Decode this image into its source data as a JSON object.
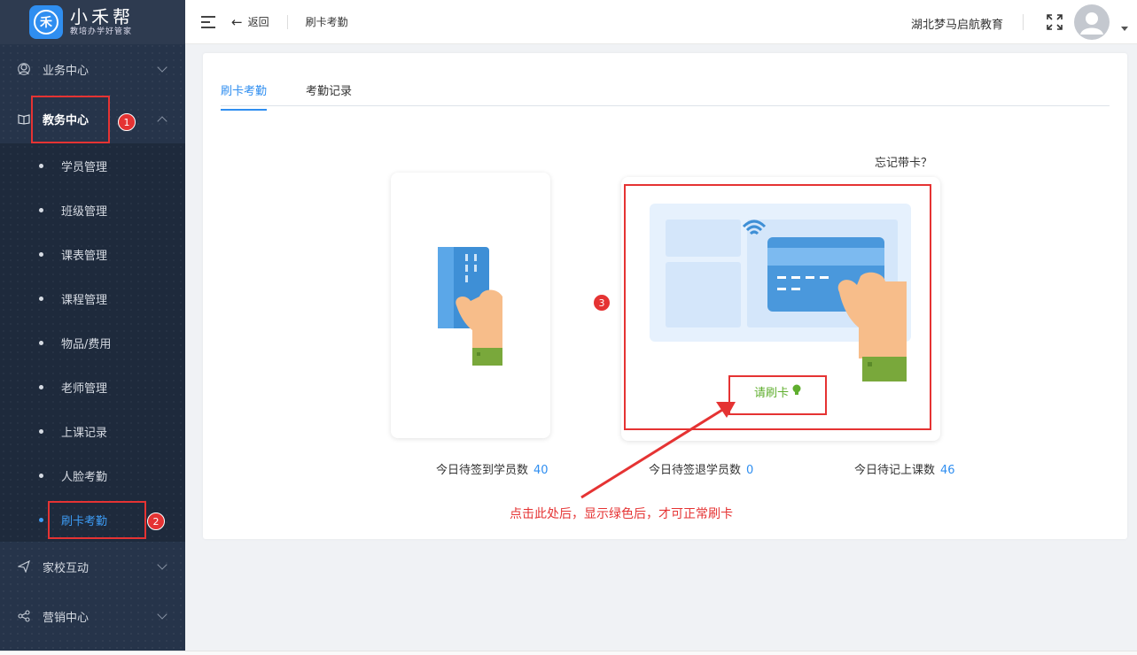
{
  "app": {
    "logo_name": "小禾帮",
    "logo_sub": "教培办学好管家",
    "logo_glyph": "禾"
  },
  "sidebar": {
    "groups": [
      {
        "label": "业务中心",
        "icon": "user-icon"
      },
      {
        "label": "教务中心",
        "icon": "book-icon"
      }
    ],
    "sub_items": [
      "学员管理",
      "班级管理",
      "课表管理",
      "课程管理",
      "物品/费用",
      "老师管理",
      "上课记录",
      "人脸考勤",
      "刷卡考勤"
    ],
    "bottom_groups": [
      {
        "label": "家校互动",
        "icon": "send-icon"
      },
      {
        "label": "营销中心",
        "icon": "share-icon"
      }
    ],
    "active_item": "刷卡考勤"
  },
  "header": {
    "back_label": "返回",
    "breadcrumb": "刷卡考勤",
    "org_name": "湖北梦马启航教育"
  },
  "tabs": [
    {
      "label": "刷卡考勤",
      "active": true
    },
    {
      "label": "考勤记录",
      "active": false
    }
  ],
  "main": {
    "forgot_card": "忘记带卡？",
    "swipe_prompt": "请刷卡",
    "stats": [
      {
        "label": "今日待签到学员数",
        "value": "40"
      },
      {
        "label": "今日待签退学员数",
        "value": "0"
      },
      {
        "label": "今日待记上课数",
        "value": "46"
      }
    ]
  },
  "annotations": {
    "badges": [
      "1",
      "2",
      "3"
    ],
    "note": "点击此处后，显示绿色后，才可正常刷卡"
  },
  "colors": {
    "accent": "#2f8ef0",
    "sidebar_bg": "#26344a",
    "annotation_red": "#e53333",
    "success_green": "#5fae2e"
  }
}
